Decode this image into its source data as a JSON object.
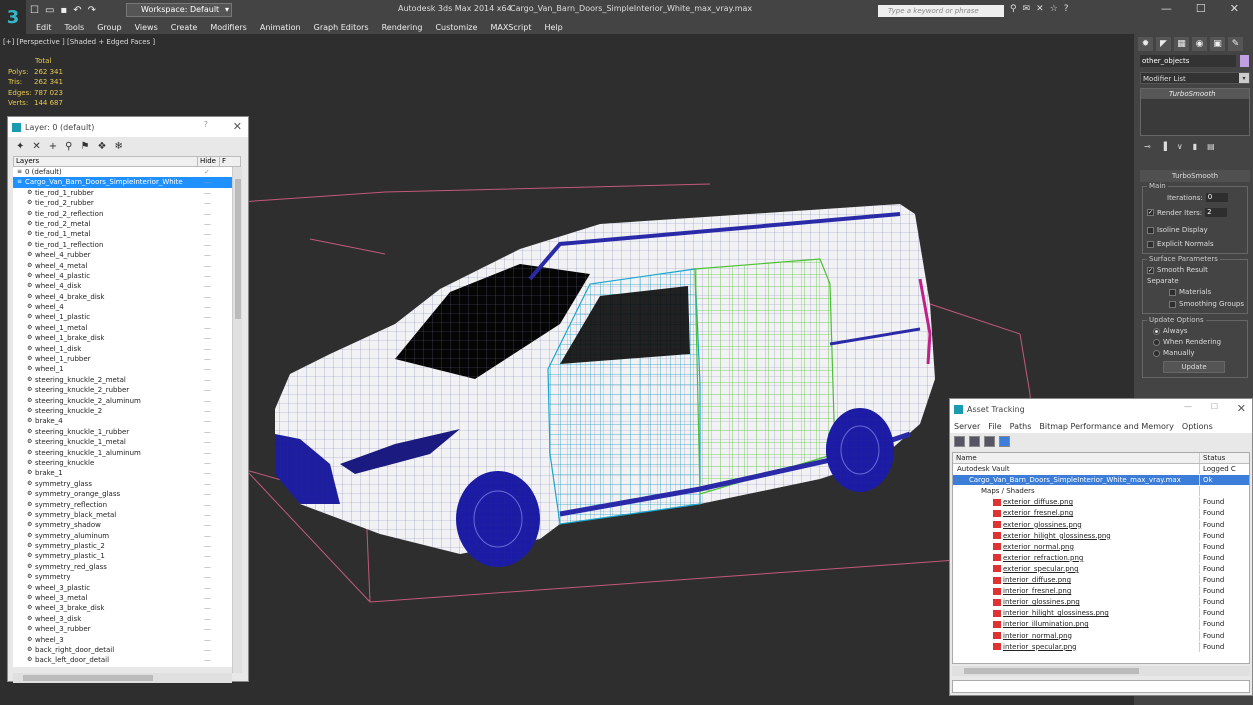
{
  "app": {
    "title": "Autodesk 3ds Max 2014 x64",
    "file": "Cargo_Van_Barn_Doors_SimpleInterior_White_max_vray.max",
    "workspace": "Workspace: Default",
    "search_placeholder": "Type a keyword or phrase"
  },
  "menu": [
    "Edit",
    "Tools",
    "Group",
    "Views",
    "Create",
    "Modifiers",
    "Animation",
    "Graph Editors",
    "Rendering",
    "Customize",
    "MAXScript",
    "Help"
  ],
  "viewport": {
    "label": "[+] [Perspective ] [Shaded + Edged Faces ]",
    "stats": {
      "header": "Total",
      "rows": [
        {
          "k": "Polys:",
          "v": "262 341"
        },
        {
          "k": "Tris:",
          "v": "262 341"
        },
        {
          "k": "Edges:",
          "v": "787 023"
        },
        {
          "k": "Verts:",
          "v": "144 687"
        }
      ]
    }
  },
  "command_panel": {
    "object_name": "other_objects",
    "object_color": "#c0a0e0",
    "modifier_list": "Modifier List",
    "stack_item": "TurboSmooth",
    "rollout_title": "TurboSmooth",
    "main_label": "Main",
    "iterations_label": "Iterations:",
    "iterations_value": "0",
    "render_iters_label": "Render Iters:",
    "render_iters_value": "2",
    "isoline": "Isoline Display",
    "explicit_normals": "Explicit Normals",
    "surface_params": "Surface Parameters",
    "smooth_result": "Smooth Result",
    "separate": "Separate",
    "materials": "Materials",
    "smoothing_groups": "Smoothing Groups",
    "update_options": "Update Options",
    "always": "Always",
    "when_rendering": "When Rendering",
    "manually": "Manually",
    "update_button": "Update"
  },
  "layers_panel": {
    "title": "Layer: 0 (default)",
    "col_layers": "Layers",
    "col_hide": "Hide",
    "col_f": "F",
    "rows": [
      "0 (default)",
      "Cargo_Van_Barn_Doors_SimpleInterior_White",
      "tie_rod_1_rubber",
      "tie_rod_2_rubber",
      "tie_rod_2_reflection",
      "tie_rod_2_metal",
      "tie_rod_1_metal",
      "tie_rod_1_reflection",
      "wheel_4_rubber",
      "wheel_4_metal",
      "wheel_4_plastic",
      "wheel_4_disk",
      "wheel_4_brake_disk",
      "wheel_4",
      "wheel_1_plastic",
      "wheel_1_metal",
      "wheel_1_brake_disk",
      "wheel_1_disk",
      "wheel_1_rubber",
      "wheel_1",
      "steering_knuckle_2_metal",
      "steering_knuckle_2_rubber",
      "steering_knuckle_2_aluminum",
      "steering_knuckle_2",
      "brake_4",
      "steering_knuckle_1_rubber",
      "steering_knuckle_1_metal",
      "steering_knuckle_1_aluminum",
      "steering_knuckle",
      "brake_1",
      "symmetry_glass",
      "symmetry_orange_glass",
      "symmetry_reflection",
      "symmetry_black_metal",
      "symmetry_shadow",
      "symmetry_aluminum",
      "symmetry_plastic_2",
      "symmetry_plastic_1",
      "symmetry_red_glass",
      "symmetry",
      "wheel_3_plastic",
      "wheel_3_metal",
      "wheel_3_brake_disk",
      "wheel_3_disk",
      "wheel_3_rubber",
      "wheel_3",
      "back_right_door_detail",
      "back_left_door_detail"
    ]
  },
  "asset_panel": {
    "title": "Asset Tracking",
    "menu": [
      "Server",
      "File",
      "Paths",
      "Bitmap Performance and Memory",
      "Options"
    ],
    "col_name": "Name",
    "col_status": "Status",
    "rows": [
      {
        "name": "Autodesk Vault",
        "status": "Logged C",
        "indent": 1
      },
      {
        "name": "Cargo_Van_Barn_Doors_SimpleInterior_White_max_vray.max",
        "status": "Ok",
        "indent": 2
      },
      {
        "name": "Maps / Shaders",
        "status": "",
        "indent": 3
      },
      {
        "name": "exterior_diffuse.png",
        "status": "Found",
        "indent": 4
      },
      {
        "name": "exterior_fresnel.png",
        "status": "Found",
        "indent": 4
      },
      {
        "name": "exterior_glossines.png",
        "status": "Found",
        "indent": 4
      },
      {
        "name": "exterior_hilight_glossiness.png",
        "status": "Found",
        "indent": 4
      },
      {
        "name": "exterior_normal.png",
        "status": "Found",
        "indent": 4
      },
      {
        "name": "exterior_refraction.png",
        "status": "Found",
        "indent": 4
      },
      {
        "name": "exterior_specular.png",
        "status": "Found",
        "indent": 4
      },
      {
        "name": "interior_diffuse.png",
        "status": "Found",
        "indent": 4
      },
      {
        "name": "interior_fresnel.png",
        "status": "Found",
        "indent": 4
      },
      {
        "name": "interior_glossines.png",
        "status": "Found",
        "indent": 4
      },
      {
        "name": "interior_hilight_glossiness.png",
        "status": "Found",
        "indent": 4
      },
      {
        "name": "interior_illumination.png",
        "status": "Found",
        "indent": 4
      },
      {
        "name": "interior_normal.png",
        "status": "Found",
        "indent": 4
      },
      {
        "name": "interior_specular.png",
        "status": "Found",
        "indent": 4
      }
    ]
  }
}
